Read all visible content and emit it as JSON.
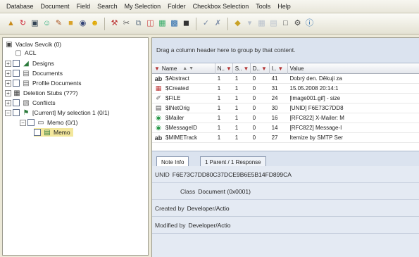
{
  "menu": [
    "Database",
    "Document",
    "Field",
    "Search",
    "My Selection",
    "Folder",
    "Checkbox Selection",
    "Tools",
    "Help"
  ],
  "tree": {
    "root": "Vaclav Sevcik (0)",
    "acl": "ACL",
    "designs": "Designs",
    "documents": "Documents",
    "profile_documents": "Profile Documents",
    "deletion_stubs": "Deletion Stubs (???)",
    "conflicts": "Conflicts",
    "my_selection": "[Current] My selection 1  (0/1)",
    "memo_folder": "Memo  (0/1)",
    "memo": "Memo"
  },
  "grid": {
    "group_hint": "Drag a column header here to group by that content.",
    "headers": {
      "name": "Name",
      "n": "N..",
      "s": "S..",
      "d": "D..",
      "l": "I..",
      "value": "Value"
    },
    "rows": [
      {
        "icon": "ab",
        "name": "$Abstract",
        "n": "1",
        "s": "1",
        "d": "0",
        "l": "41",
        "value": "Dobrý den. Děkuji za"
      },
      {
        "icon": "cal",
        "name": "$Created",
        "n": "1",
        "s": "1",
        "d": "0",
        "l": "31",
        "value": "15.05.2008 20:14:1"
      },
      {
        "icon": "clip",
        "name": "$FILE",
        "n": "1",
        "s": "1",
        "d": "0",
        "l": "24",
        "value": "[image001.gif] - size"
      },
      {
        "icon": "doc",
        "name": "$INetOrig",
        "n": "1",
        "s": "1",
        "d": "0",
        "l": "30",
        "value": "[UNID] F6E73C7DD8"
      },
      {
        "icon": "globe",
        "name": "$Mailer",
        "n": "1",
        "s": "1",
        "d": "0",
        "l": "16",
        "value": "[RFC822] X-Mailer: M"
      },
      {
        "icon": "globe",
        "name": "$MessageID",
        "n": "1",
        "s": "1",
        "d": "0",
        "l": "14",
        "value": "[RFC822] Message-I"
      },
      {
        "icon": "ab",
        "name": "$MIMETrack",
        "n": "1",
        "s": "1",
        "d": "0",
        "l": "27",
        "value": "Itemize by SMTP Ser"
      }
    ]
  },
  "tabs": {
    "note_info": "Note Info",
    "parent_response": "1 Parent / 1 Response"
  },
  "details": {
    "unid_label": "UNID",
    "unid_value": "F6E73C7DD80C37DCE9B6E5B14FD899CA",
    "class_label": "Class",
    "class_value": "Document (0x0001)",
    "created_label": "Created by",
    "created_value": "Developer/Actio",
    "modified_label": "Modified by",
    "modified_value": "Developer/Actio"
  },
  "colors": {
    "accent": "#dbe3ef",
    "filter": "#b23333"
  }
}
